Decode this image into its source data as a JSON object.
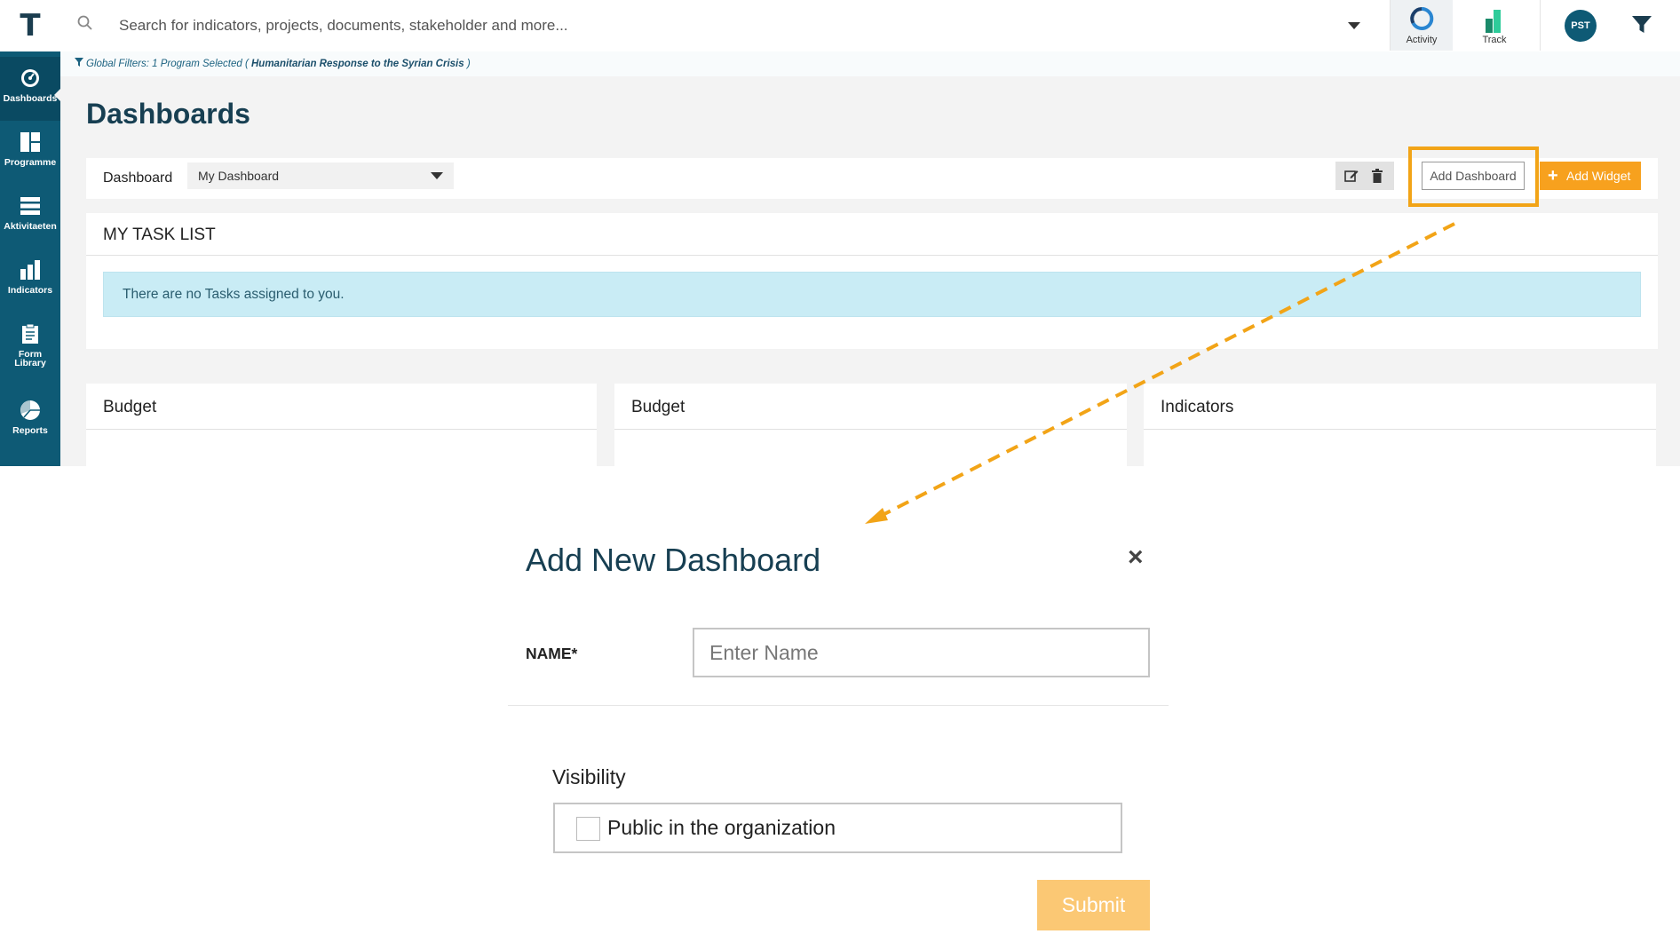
{
  "app": {
    "logo_letter": "T"
  },
  "topbar": {
    "search_placeholder": "Search for indicators, projects, documents, stakeholder and more...",
    "activity_label": "Activity",
    "track_label": "Track",
    "avatar_initials": "PST"
  },
  "sidebar": {
    "items": [
      {
        "label": "Dashboards",
        "icon": "gauge-icon",
        "active": true
      },
      {
        "label": "Programme",
        "icon": "grid-icon"
      },
      {
        "label": "Aktivitaeten",
        "icon": "stack-icon"
      },
      {
        "label": "Indicators",
        "icon": "bar-chart-icon"
      },
      {
        "label": "Form Library",
        "icon": "clipboard-icon"
      },
      {
        "label": "Reports",
        "icon": "pie-chart-icon"
      }
    ]
  },
  "global_filter": {
    "prefix": "Global Filters: 1 Program Selected (",
    "program": "Humanitarian Response to the Syrian Crisis",
    "suffix": ")"
  },
  "page": {
    "title": "Dashboards",
    "dashboard_label": "Dashboard",
    "dashboard_selected": "My Dashboard",
    "add_dashboard_label": "Add Dashboard",
    "add_widget_label": "Add Widget"
  },
  "task_list": {
    "title": "MY TASK LIST",
    "empty_message": "There are no Tasks assigned to you."
  },
  "widgets": [
    {
      "title": "Budget"
    },
    {
      "title": "Budget"
    },
    {
      "title": "Indicators"
    }
  ],
  "modal": {
    "title": "Add New Dashboard",
    "close": "×",
    "name_label": "NAME*",
    "name_placeholder": "Enter Name",
    "visibility_label": "Visibility",
    "public_option": "Public in the organization",
    "public_checked": false,
    "submit_label": "Submit"
  },
  "colors": {
    "brand": "#0e5a75",
    "accent": "#f7a11e",
    "highlight": "#f2a417"
  }
}
